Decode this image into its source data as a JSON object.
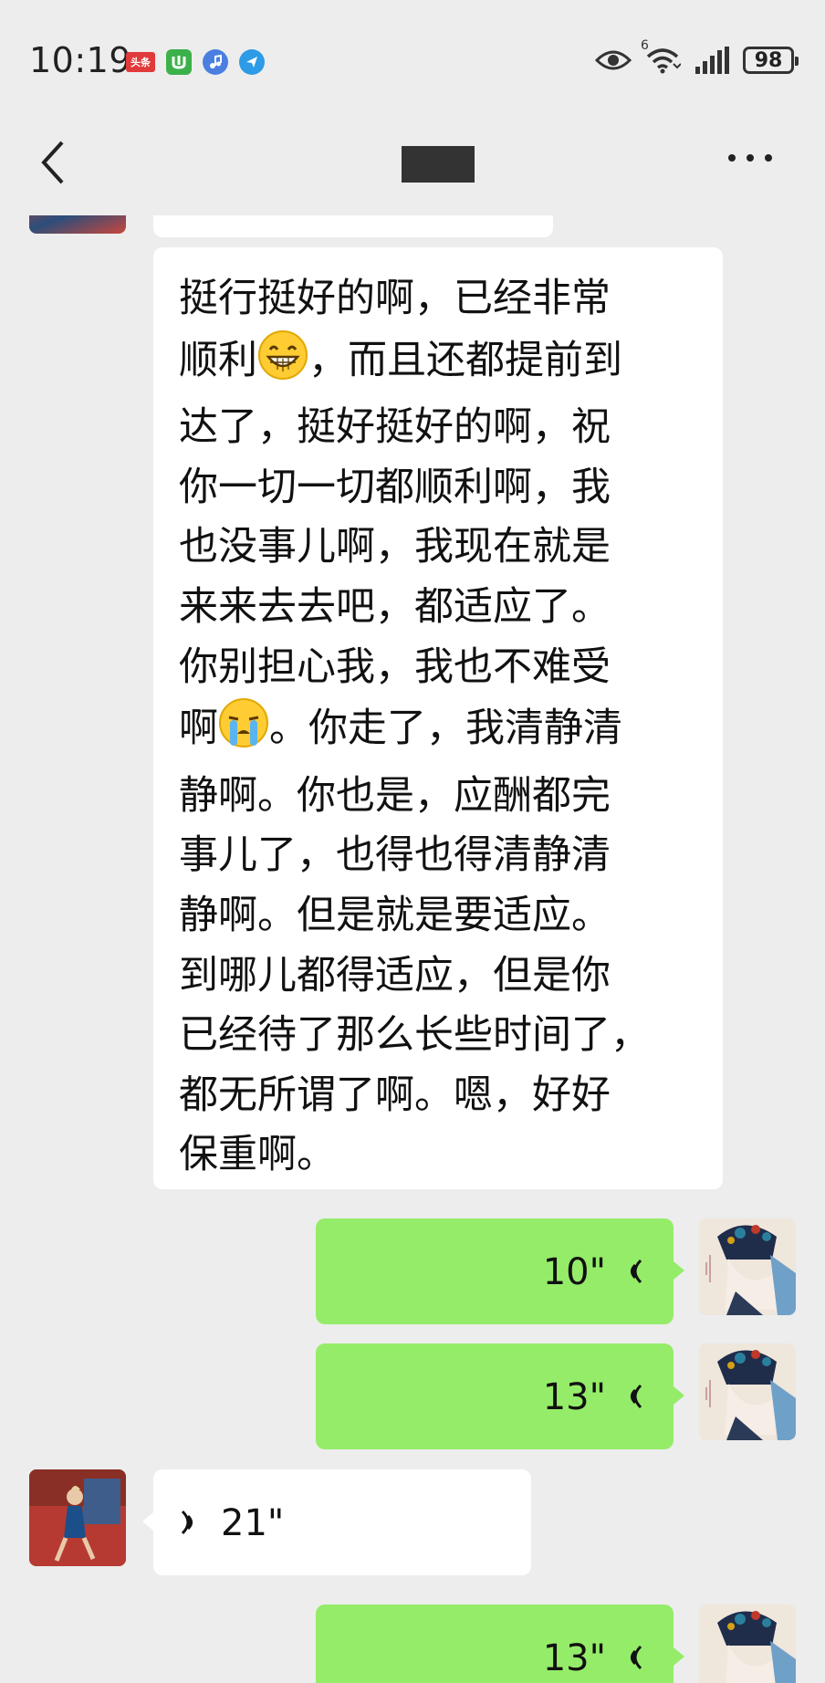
{
  "status_bar": {
    "time": "10:19",
    "notification_icons": [
      "toutiao-icon",
      "app-green-icon",
      "music-icon",
      "browser-icon"
    ],
    "toutiao_label": "头条",
    "wifi_badge": "6",
    "battery_level": "98"
  },
  "header": {
    "back_icon": "chevron-left-icon",
    "more_icon": "more-dots-icon"
  },
  "messages": [
    {
      "type": "text",
      "side": "left",
      "lines": [
        "挺行挺好的啊，已经非常",
        "顺利",
        "，而且还都提前到",
        "达了，挺好挺好的啊，祝",
        "你一切一切都顺利啊，我",
        "也没事儿啊，我现在就是",
        "来来去去吧，都适应了。",
        "你别担心我，我也不难受",
        "啊",
        "。你走了，我清静清",
        "静啊。你也是，应酬都完",
        "事儿了，也得也得清静清",
        "静啊。但是就是要适应。",
        "到哪儿都得适应，但是你",
        "已经待了那么长些时间了，",
        "都无所谓了啊。嗯，好好",
        "保重啊。"
      ],
      "emojis": [
        "grinning-face-icon",
        "crying-face-icon"
      ]
    },
    {
      "type": "voice",
      "side": "right",
      "duration": "10\""
    },
    {
      "type": "voice",
      "side": "right",
      "duration": "13\""
    },
    {
      "type": "voice",
      "side": "left",
      "duration": "21\""
    },
    {
      "type": "voice",
      "side": "right",
      "duration": "13\""
    }
  ],
  "colors": {
    "background": "#ededed",
    "self_bubble": "#95ec69",
    "other_bubble": "#ffffff"
  }
}
